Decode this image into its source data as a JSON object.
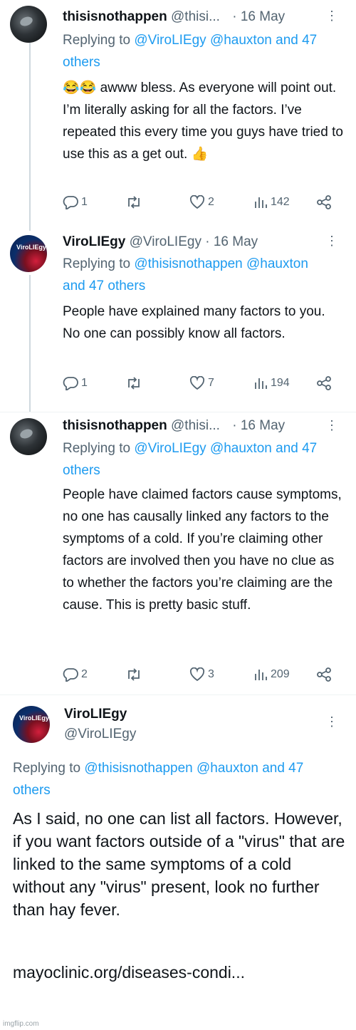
{
  "tweets": [
    {
      "name": "thisisnothappen",
      "handle": "@thisi...",
      "time": "· 16 May",
      "reply_prefix": "Replying to",
      "reply_users": "@ViroLIEgy @hauxton",
      "reply_rest": "and 47 others",
      "emoji": "😂😂",
      "text": "awww bless. As everyone will point out. I’m literally asking for all the factors. I’ve repeated this every time you guys have tried to use this as a get out.",
      "trailing_emoji": "👍",
      "replies": "1",
      "retweets": "",
      "likes": "2",
      "views": "142"
    },
    {
      "name": "ViroLIEgy",
      "handle": "@ViroLIEgy",
      "time": "· 16 May",
      "reply_prefix": "Replying to",
      "reply_users": "@thisisnothappen",
      "reply_rest": "@hauxton and 47 others",
      "text": "People have explained many factors to you. No one can possibly know all factors.",
      "replies": "1",
      "retweets": "",
      "likes": "7",
      "views": "194"
    },
    {
      "name": "thisisnothappen",
      "handle": "@thisi...",
      "time": "· 16 May",
      "reply_prefix": "Replying to",
      "reply_users": "@ViroLIEgy @hauxton",
      "reply_rest": "and 47 others",
      "text": "People have claimed factors cause symptoms, no one has causally linked any factors to the symptoms of a cold. If you’re claiming other factors are involved then you have no clue as to whether the factors you’re claiming are the cause. This is pretty basic stuff.",
      "replies": "2",
      "retweets": "",
      "likes": "3",
      "views": "209"
    },
    {
      "name": "ViroLIEgy",
      "handle": "@ViroLIEgy",
      "reply_prefix": "Replying to",
      "reply_users": "@thisisnothappen @hauxton",
      "reply_rest": "and 47 others",
      "text": "As I said, no one can list all factors. However, if you want factors outside of a \"virus\" that are linked to the same symptoms of a cold without any \"virus\" present, look no further than hay fever.",
      "link": "mayoclinic.org/diseases-condi..."
    }
  ],
  "avatar_text": "ViroLIEgy",
  "more_icon": "⋮",
  "watermark": "imgflip.com",
  "colors": {
    "link": "#1d9bf0",
    "muted": "#536471",
    "text": "#0f1419"
  }
}
